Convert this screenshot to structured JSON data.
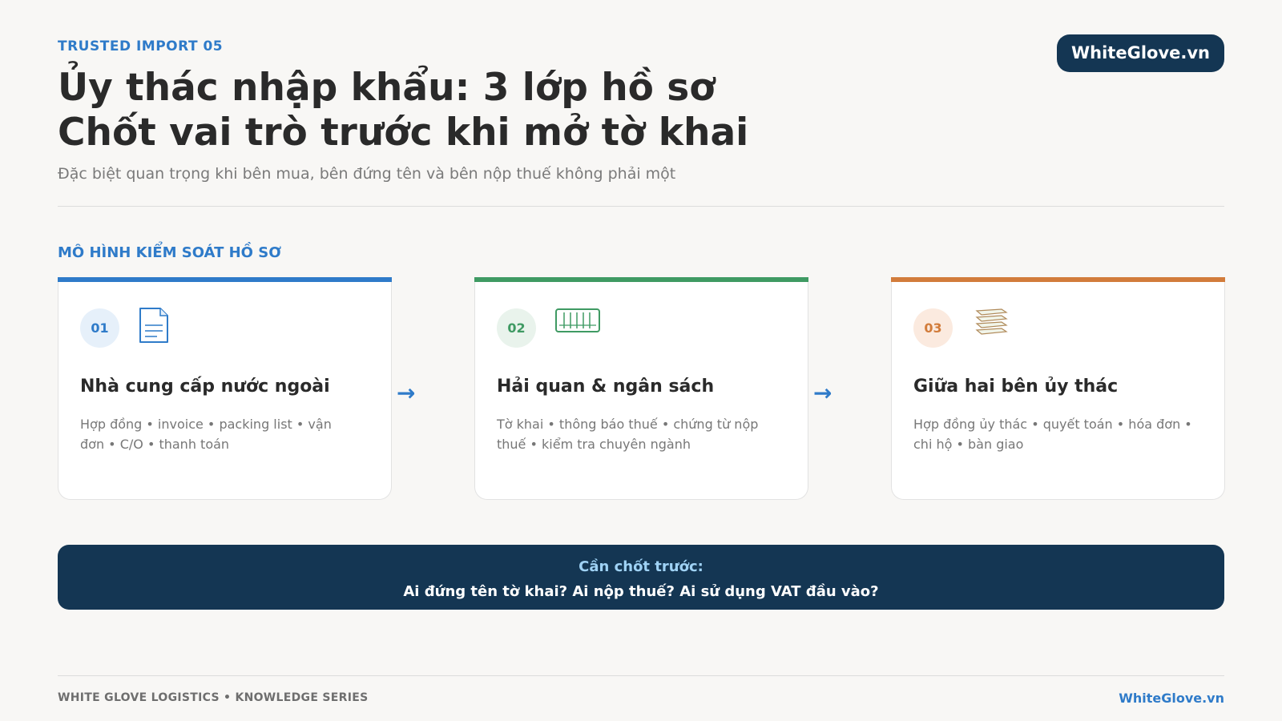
{
  "header": {
    "eyebrow": "TRUSTED IMPORT 05",
    "brand": "WhiteGlove.vn",
    "title_line1": "Ủy thác nhập khẩu: 3 lớp hồ sơ",
    "title_line2": "Chốt vai trò trước khi mở tờ khai",
    "subtitle": "Đặc biệt quan trọng khi bên mua, bên đứng tên và bên nộp thuế không phải một"
  },
  "section": {
    "label": "MÔ HÌNH KIỂM SOÁT HỒ SƠ"
  },
  "cards": [
    {
      "number": "01",
      "title": "Nhà cung cấp nước ngoài",
      "description": "Hợp đồng • invoice • packing list • vận đơn • C/O • thanh toán",
      "accent": "#2f7bc9",
      "badge_bg": "#e6f0fa",
      "icon": "document-icon"
    },
    {
      "number": "02",
      "title": "Hải quan & ngân sách",
      "description": "Tờ khai • thông báo thuế • chứng từ nộp thuế • kiểm tra chuyên ngành",
      "accent": "#3f9a63",
      "badge_bg": "#e9f3ec",
      "icon": "customs-gate-icon"
    },
    {
      "number": "03",
      "title": "Giữa hai bên ủy thác",
      "description": "Hợp đồng ủy thác • quyết toán • hóa đơn • chi hộ • bàn giao",
      "accent": "#d27c3b",
      "badge_bg": "#fbeadf",
      "icon": "stacked-papers-icon"
    }
  ],
  "flow": {
    "arrow_glyph": "→"
  },
  "callout": {
    "label": "Cần chốt trước:",
    "text": "Ai đứng tên tờ khai? Ai nộp thuế? Ai sử dụng VAT đầu vào?"
  },
  "footer": {
    "left": "WHITE GLOVE LOGISTICS • KNOWLEDGE SERIES",
    "right": "WhiteGlove.vn"
  }
}
